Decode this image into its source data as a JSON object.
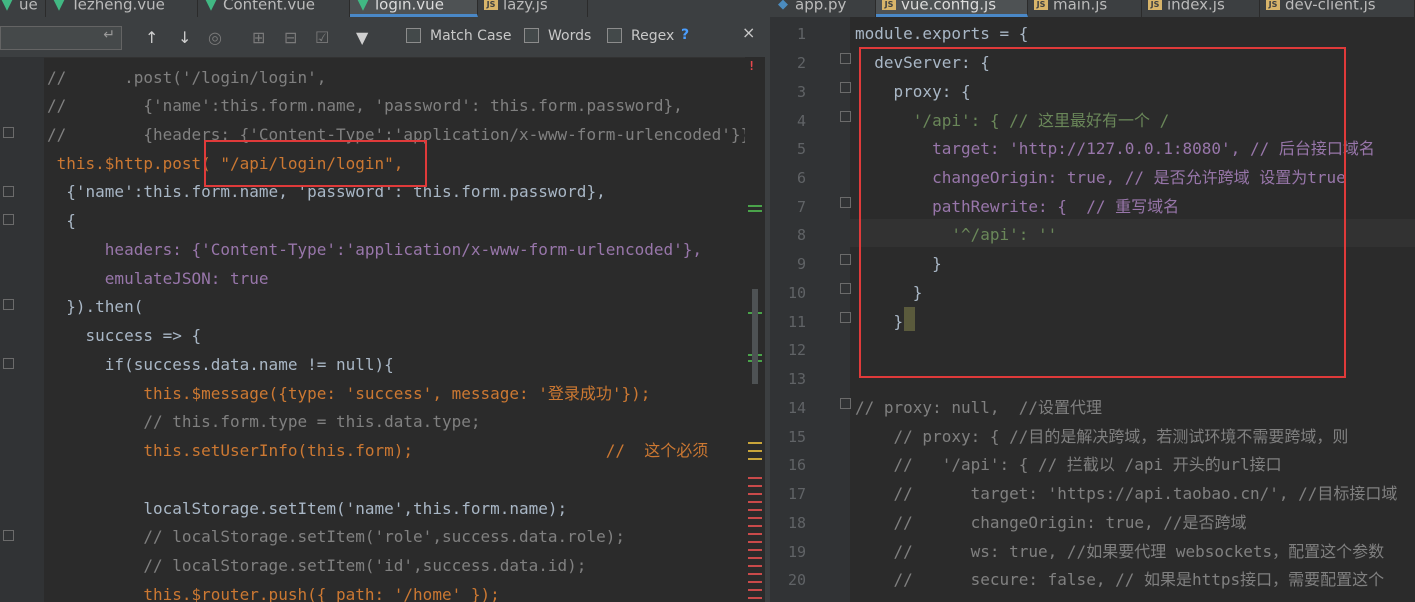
{
  "left_tabs": [
    {
      "label": "ue",
      "icon": "vue-icon",
      "active": false
    },
    {
      "label": "Tezheng.vue",
      "icon": "vue-icon",
      "active": false
    },
    {
      "label": "Content.vue",
      "icon": "vue-icon",
      "active": false
    },
    {
      "label": "login.vue",
      "icon": "vue-icon",
      "active": true
    },
    {
      "label": "lazy.js",
      "icon": "js-icon",
      "active": false
    }
  ],
  "right_tabs": [
    {
      "label": "app.py",
      "icon": "python-icon",
      "active": false
    },
    {
      "label": "vue.config.js",
      "icon": "js-icon",
      "active": true
    },
    {
      "label": "main.js",
      "icon": "js-icon",
      "active": false
    },
    {
      "label": "index.js",
      "icon": "js-icon",
      "active": false
    },
    {
      "label": "dev-client.js",
      "icon": "js-icon",
      "active": false
    }
  ],
  "find_bar": {
    "search_value": "",
    "match_case": "Match Case",
    "words": "Words",
    "regex": "Regex",
    "help": "?",
    "close": "×",
    "enter_glyph": "↵"
  },
  "left_code": [
    "//      .post('/login/login',",
    "//        {'name':this.form.name, 'password': this.form.password},",
    "//        {headers: {'Content-Type':'application/x-www-form-urlencoded'}}",
    " this.$http.post( \"/api/login/login\",",
    "  {'name':this.form.name, 'password': this.form.password},",
    "  {",
    "      headers: {'Content-Type':'application/x-www-form-urlencoded'},",
    "      emulateJSON: true",
    "  }).then(",
    "    success => {",
    "      if(success.data.name != null){",
    "          this.$message({type: 'success', message: '登录成功'});",
    "          // this.form.type = this.data.type;",
    "          this.setUserInfo(this.form);                    //  这个必须",
    "",
    "          localStorage.setItem('name',this.form.name);",
    "          // localStorage.setItem('role',success.data.role);",
    "          // localStorage.setItem('id',success.data.id);",
    "          this.$router.push({ path: '/home' });"
  ],
  "right_lines": [
    "1",
    "2",
    "3",
    "4",
    "5",
    "6",
    "7",
    "8",
    "9",
    "10",
    "11",
    "12",
    "13",
    "14",
    "15",
    "16",
    "17",
    "18",
    "19",
    "20"
  ],
  "right_code": [
    "module.exports = {",
    "  devServer: {",
    "    proxy: {",
    "      '/api': { // 这里最好有一个 /",
    "        target: 'http://127.0.0.1:8080', // 后台接口域名",
    "        changeOrigin: true, // 是否允许跨域 设置为true",
    "        pathRewrite: {  // 重写域名",
    "          '^/api': ''",
    "        }",
    "      }",
    "    }",
    "",
    "",
    "// proxy: null,  //设置代理",
    "    // proxy: { //目的是解决跨域，若测试环境不需要跨域，则",
    "    //   '/api': { // 拦截以 /api 开头的url接口",
    "    //      target: 'https://api.taobao.cn/', //目标接口域",
    "    //      changeOrigin: true, //是否跨域",
    "    //      ws: true, //如果要代理 websockets，配置这个参数",
    "    //      secure: false, // 如果是https接口，需要配置这个"
  ],
  "colors": {
    "background": "#2b2b2b",
    "keyword": "#cc7832",
    "string": "#6a8759",
    "property": "#9876aa",
    "comment": "#808080",
    "highlight_box": "#e03a3a"
  }
}
